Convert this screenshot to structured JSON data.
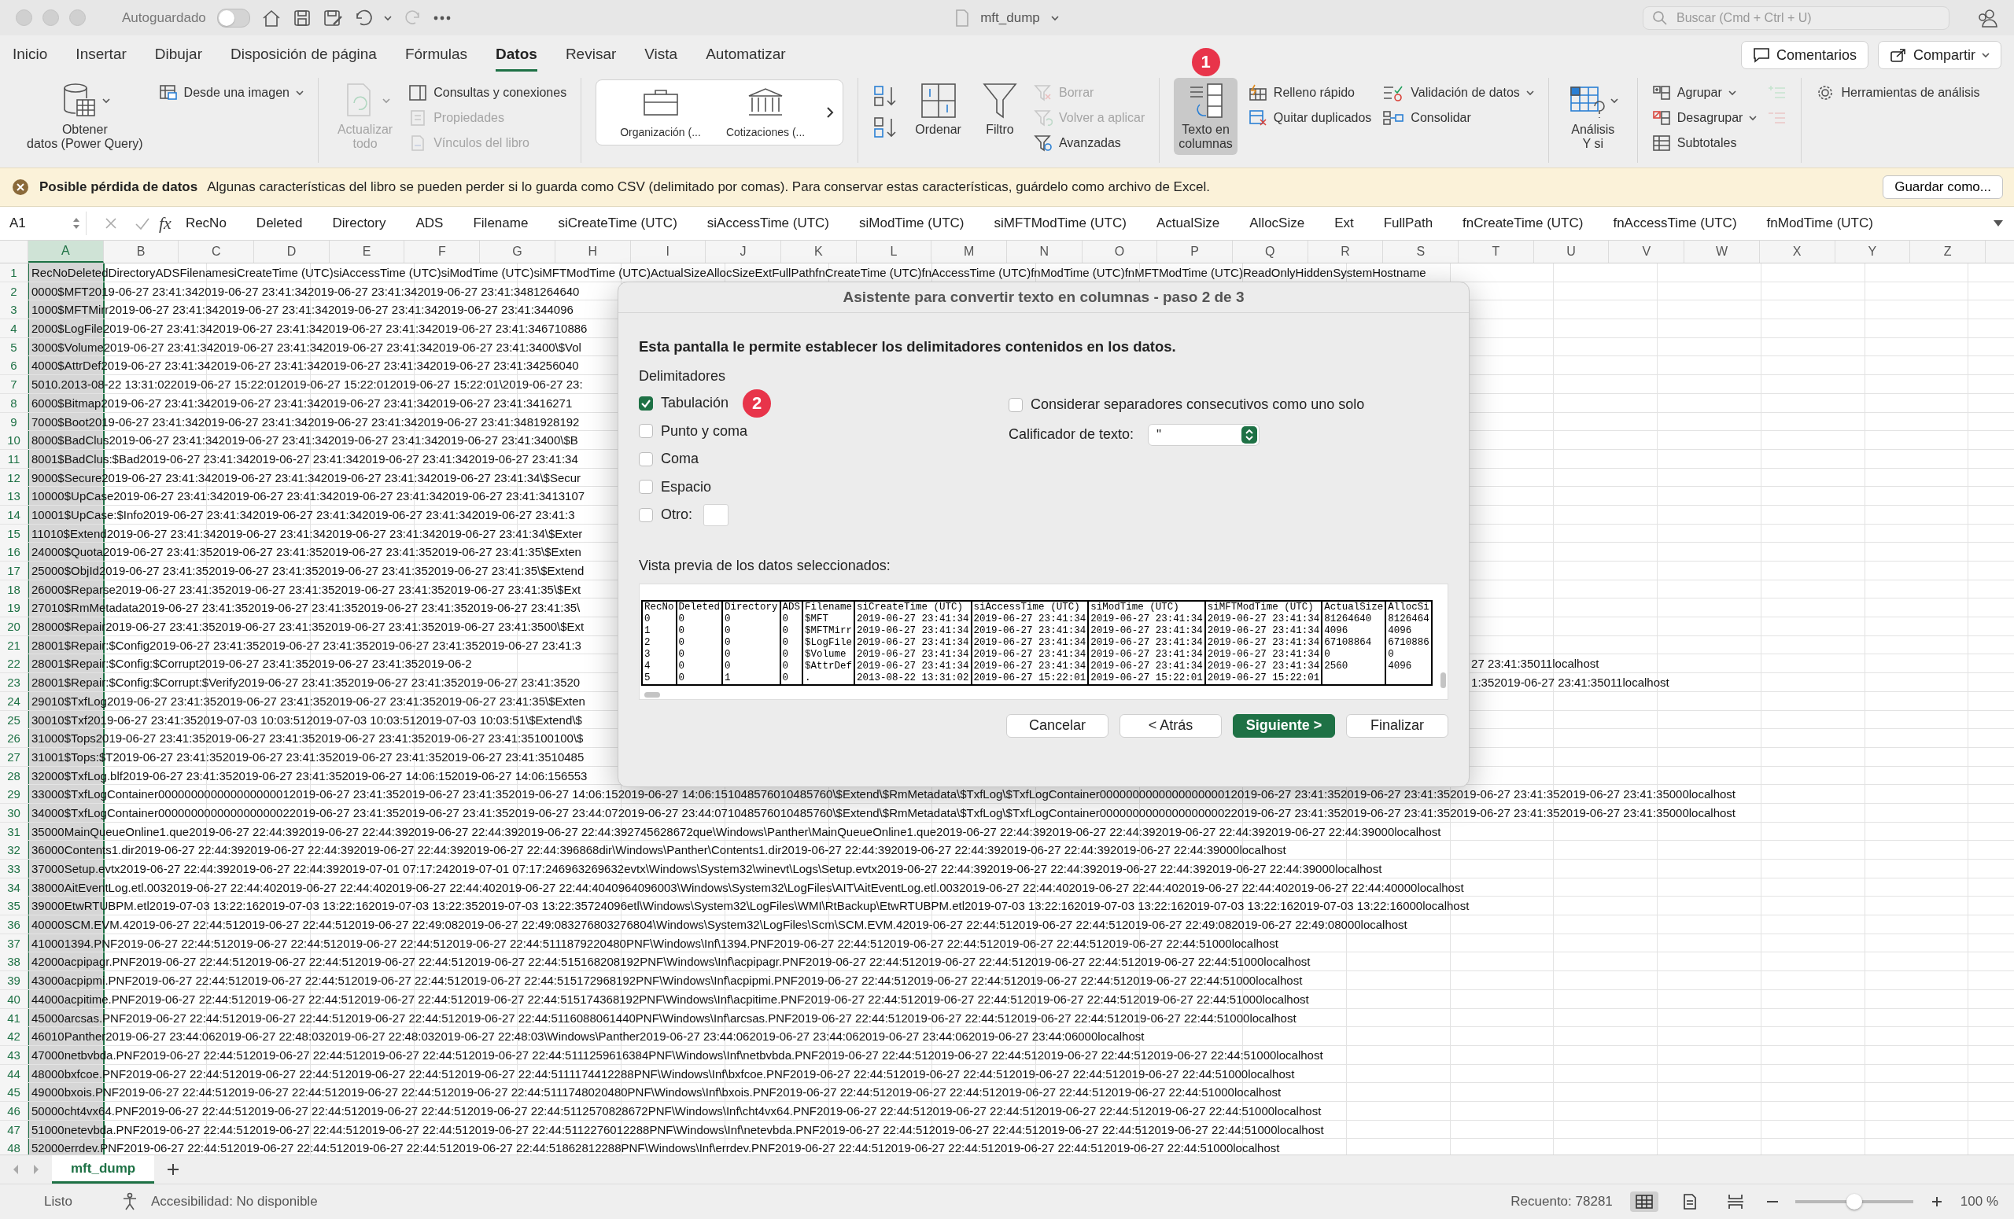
{
  "title_bar": {
    "autosave_label": "Autoguardado",
    "autosave_on": false,
    "file_name": "mft_dump",
    "search": {
      "placeholder": "Buscar (Cmd + Ctrl + U)"
    }
  },
  "ribbon_tabs": [
    {
      "label": "Inicio",
      "selected": false
    },
    {
      "label": "Insertar",
      "selected": false
    },
    {
      "label": "Dibujar",
      "selected": false
    },
    {
      "label": "Disposición de página",
      "selected": false
    },
    {
      "label": "Fórmulas",
      "selected": false
    },
    {
      "label": "Datos",
      "selected": true
    },
    {
      "label": "Revisar",
      "selected": false
    },
    {
      "label": "Vista",
      "selected": false
    },
    {
      "label": "Automatizar",
      "selected": false
    }
  ],
  "header_buttons": [
    {
      "label": "Comentarios",
      "dropdown": false
    },
    {
      "label": "Compartir",
      "dropdown": true
    }
  ],
  "ribbon": {
    "groups": [
      {
        "items": [
          {
            "kind": "large",
            "label": "Obtener\ndatos (Power Query)",
            "dropdown": true,
            "disabled": false
          },
          {
            "kind": "stack",
            "items": [
              {
                "label": "Desde una imagen",
                "dropdown": true,
                "disabled": false
              }
            ]
          }
        ]
      },
      {
        "items": [
          {
            "kind": "large",
            "label": "Actualizar\ntodo",
            "dropdown": true,
            "disabled": true
          },
          {
            "kind": "stack",
            "items": [
              {
                "label": "Consultas y conexiones",
                "dropdown": false,
                "disabled": false
              },
              {
                "label": "Propiedades",
                "dropdown": false,
                "disabled": true
              },
              {
                "label": "Vínculos del libro",
                "dropdown": false,
                "disabled": true
              }
            ]
          }
        ]
      },
      {
        "items": [
          {
            "kind": "gallery",
            "items": [
              {
                "label": "Organización (..."
              },
              {
                "label": "Cotizaciones (..."
              }
            ]
          }
        ]
      },
      {
        "items": [
          {
            "kind": "sort"
          },
          {
            "kind": "large",
            "label": "Ordenar",
            "dropdown": false,
            "disabled": false
          },
          {
            "kind": "large",
            "label": "Filtro",
            "dropdown": false,
            "disabled": false
          },
          {
            "kind": "stack",
            "items": [
              {
                "label": "Borrar",
                "dropdown": false,
                "disabled": true
              },
              {
                "label": "Volver a aplicar",
                "dropdown": false,
                "disabled": true
              },
              {
                "label": "Avanzadas",
                "dropdown": false,
                "disabled": false
              }
            ]
          }
        ]
      },
      {
        "items": [
          {
            "kind": "large",
            "label": "Texto en\ncolumnas",
            "dropdown": false,
            "disabled": false,
            "selected": true,
            "badge": "1"
          },
          {
            "kind": "stack",
            "items": [
              {
                "label": "Relleno rápido",
                "dropdown": false,
                "disabled": false
              },
              {
                "label": "Quitar duplicados",
                "dropdown": false,
                "disabled": false
              }
            ]
          },
          {
            "kind": "stack",
            "items": [
              {
                "label": "Validación de datos",
                "dropdown": true,
                "disabled": false
              },
              {
                "label": "Consolidar",
                "dropdown": false,
                "disabled": false
              }
            ]
          }
        ]
      },
      {
        "items": [
          {
            "kind": "large",
            "label": "Análisis\nY si",
            "dropdown": true,
            "disabled": false
          }
        ]
      },
      {
        "items": [
          {
            "kind": "stack",
            "items": [
              {
                "label": "Agrupar",
                "dropdown": true,
                "disabled": false
              },
              {
                "label": "Desagrupar",
                "dropdown": true,
                "disabled": false
              },
              {
                "label": "Subtotales",
                "dropdown": false,
                "disabled": false
              }
            ]
          },
          {
            "kind": "stack",
            "items": [
              {
                "dropdown": false,
                "disabled": true
              },
              {
                "dropdown": false,
                "disabled": true
              }
            ]
          }
        ]
      },
      {
        "items": [
          {
            "kind": "stack",
            "items": [
              {
                "label": "Herramientas de análisis",
                "dropdown": false,
                "disabled": false
              }
            ]
          }
        ]
      }
    ]
  },
  "banner": {
    "title": "Posible pérdida de datos",
    "message": "Algunas características del libro se pueden perder si lo guarda como CSV (delimitado por comas). Para conservar estas características, guárdelo como archivo de Excel.",
    "button": "Guardar como..."
  },
  "formula_bar": {
    "cell": "A1",
    "fx_label": "fx",
    "contents": [
      "RecNo",
      "Deleted",
      "Directory",
      "ADS",
      "Filename",
      "siCreateTime (UTC)",
      "siAccessTime (UTC)",
      "siModTime (UTC)",
      "siMFTModTime (UTC)",
      "ActualSize",
      "AllocSize",
      "Ext",
      "FullPath",
      "fnCreateTime (UTC)",
      "fnAccessTime (UTC)",
      "fnModTime (UTC)"
    ]
  },
  "sheet": {
    "columns": [
      {
        "label": "A",
        "selected": true
      },
      {
        "label": "B",
        "selected": false
      },
      {
        "label": "C",
        "selected": false
      },
      {
        "label": "D",
        "selected": false
      },
      {
        "label": "E",
        "selected": false
      },
      {
        "label": "F",
        "selected": false
      },
      {
        "label": "G",
        "selected": false
      },
      {
        "label": "H",
        "selected": false
      },
      {
        "label": "I",
        "selected": false
      },
      {
        "label": "J",
        "selected": false
      },
      {
        "label": "K",
        "selected": false
      },
      {
        "label": "L",
        "selected": false
      },
      {
        "label": "M",
        "selected": false
      },
      {
        "label": "N",
        "selected": false
      },
      {
        "label": "O",
        "selected": false
      },
      {
        "label": "P",
        "selected": false
      },
      {
        "label": "Q",
        "selected": false
      },
      {
        "label": "R",
        "selected": false
      },
      {
        "label": "S",
        "selected": false
      },
      {
        "label": "T",
        "selected": false
      },
      {
        "label": "U",
        "selected": false
      },
      {
        "label": "V",
        "selected": false
      },
      {
        "label": "W",
        "selected": false
      },
      {
        "label": "X",
        "selected": false
      },
      {
        "label": "Y",
        "selected": false
      },
      {
        "label": "Z",
        "selected": false
      }
    ],
    "rows": [
      {
        "number": "1",
        "text": "RecNoDeletedDirectoryADSFilenamesiCreateTime (UTC)siAccessTime (UTC)siModTime (UTC)siMFTModTime (UTC)ActualSizeAllocSizeExtFullPathfnCreateTime (UTC)fnAccessTime (UTC)fnModTime (UTC)fnMFTModTime (UTC)ReadOnlyHiddenSystemHostname"
      },
      {
        "number": "2",
        "text": "0000$MFT2019-06-27 23:41:342019-06-27 23:41:342019-06-27 23:41:342019-06-27 23:41:3481264640"
      },
      {
        "number": "3",
        "text": "1000$MFTMirr2019-06-27 23:41:342019-06-27 23:41:342019-06-27 23:41:342019-06-27 23:41:344096"
      },
      {
        "number": "4",
        "text": "2000$LogFile2019-06-27 23:41:342019-06-27 23:41:342019-06-27 23:41:342019-06-27 23:41:346710886"
      },
      {
        "number": "5",
        "text": "3000$Volume2019-06-27 23:41:342019-06-27 23:41:342019-06-27 23:41:342019-06-27 23:41:3400\\$Vol"
      },
      {
        "number": "6",
        "text": "4000$AttrDef2019-06-27 23:41:342019-06-27 23:41:342019-06-27 23:41:342019-06-27 23:41:34256040"
      },
      {
        "number": "7",
        "text": "5010.2013-08-22 13:31:022019-06-27 15:22:012019-06-27 15:22:012019-06-27 15:22:01\\2019-06-27 23:"
      },
      {
        "number": "8",
        "text": "6000$Bitmap2019-06-27 23:41:342019-06-27 23:41:342019-06-27 23:41:342019-06-27 23:41:3416271"
      },
      {
        "number": "9",
        "text": "7000$Boot2019-06-27 23:41:342019-06-27 23:41:342019-06-27 23:41:342019-06-27 23:41:3481928192"
      },
      {
        "number": "10",
        "text": "8000$BadClus2019-06-27 23:41:342019-06-27 23:41:342019-06-27 23:41:342019-06-27 23:41:3400\\$B"
      },
      {
        "number": "11",
        "text": "8001$BadClus:$Bad2019-06-27 23:41:342019-06-27 23:41:342019-06-27 23:41:342019-06-27 23:41:34"
      },
      {
        "number": "12",
        "text": "9000$Secure2019-06-27 23:41:342019-06-27 23:41:342019-06-27 23:41:342019-06-27 23:41:34\\$Secur"
      },
      {
        "number": "13",
        "text": "10000$UpCase2019-06-27 23:41:342019-06-27 23:41:342019-06-27 23:41:342019-06-27 23:41:3413107"
      },
      {
        "number": "14",
        "text": "10001$UpCase:$Info2019-06-27 23:41:342019-06-27 23:41:342019-06-27 23:41:342019-06-27 23:41:3"
      },
      {
        "number": "15",
        "text": "11010$Extend2019-06-27 23:41:342019-06-27 23:41:342019-06-27 23:41:342019-06-27 23:41:34\\$Exter"
      },
      {
        "number": "16",
        "text": "24000$Quota2019-06-27 23:41:352019-06-27 23:41:352019-06-27 23:41:352019-06-27 23:41:35\\$Exten"
      },
      {
        "number": "17",
        "text": "25000$ObjId2019-06-27 23:41:352019-06-27 23:41:352019-06-27 23:41:352019-06-27 23:41:35\\$Extend"
      },
      {
        "number": "18",
        "text": "26000$Reparse2019-06-27 23:41:352019-06-27 23:41:352019-06-27 23:41:352019-06-27 23:41:35\\$Ext"
      },
      {
        "number": "19",
        "text": "27010$RmMetadata2019-06-27 23:41:352019-06-27 23:41:352019-06-27 23:41:352019-06-27 23:41:35\\"
      },
      {
        "number": "20",
        "text": "28000$Repair2019-06-27 23:41:352019-06-27 23:41:352019-06-27 23:41:352019-06-27 23:41:3500\\$Ext"
      },
      {
        "number": "21",
        "text": "28001$Repair:$Config2019-06-27 23:41:352019-06-27 23:41:352019-06-27 23:41:352019-06-27 23:41:3"
      },
      {
        "number": "22",
        "text": "28001$Repair:$Config:$Corrupt2019-06-27 23:41:352019-06-27 23:41:352019-06-2",
        "text_right": "27 23:41:35011localhost"
      },
      {
        "number": "23",
        "text": "28001$Repair:$Config:$Corrupt:$Verify2019-06-27 23:41:352019-06-27 23:41:352019-06-27 23:41:3520",
        "text_right": "1:352019-06-27 23:41:35011localhost"
      },
      {
        "number": "24",
        "text": "29010$TxfLog2019-06-27 23:41:352019-06-27 23:41:352019-06-27 23:41:352019-06-27 23:41:35\\$Exten"
      },
      {
        "number": "25",
        "text": "30010$Txf2019-06-27 23:41:352019-07-03 10:03:512019-07-03 10:03:512019-07-03 10:03:51\\$Extend\\$"
      },
      {
        "number": "26",
        "text": "31000$Tops2019-06-27 23:41:352019-06-27 23:41:352019-06-27 23:41:352019-06-27 23:41:35100100\\$"
      },
      {
        "number": "27",
        "text": "31001$Tops:$T2019-06-27 23:41:352019-06-27 23:41:352019-06-27 23:41:352019-06-27 23:41:3510485"
      },
      {
        "number": "28",
        "text": "32000$TxfLog.blf2019-06-27 23:41:352019-06-27 23:41:352019-06-27 14:06:152019-06-27 14:06:156553"
      },
      {
        "number": "29",
        "text": "33000$TxfLogContainer000000000000000000012019-06-27 23:41:352019-06-27 23:41:352019-06-27 14:06:152019-06-27 14:06:151048576010485760\\$Extend\\$RmMetadata\\$TxfLog\\$TxfLogContainer000000000000000000012019-06-27 23:41:352019-06-27 23:41:352019-06-27 23:41:352019-06-27 23:41:35000localhost"
      },
      {
        "number": "30",
        "text": "34000$TxfLogContainer000000000000000000022019-06-27 23:41:352019-06-27 23:41:352019-06-27 23:44:072019-06-27 23:44:071048576010485760\\$Extend\\$RmMetadata\\$TxfLog\\$TxfLogContainer000000000000000000022019-06-27 23:41:352019-06-27 23:41:352019-06-27 23:41:352019-06-27 23:41:35000localhost"
      },
      {
        "number": "31",
        "text": "35000MainQueueOnline1.que2019-06-27 22:44:392019-06-27 22:44:392019-06-27 22:44:392019-06-27 22:44:392745628672que\\Windows\\Panther\\MainQueueOnline1.que2019-06-27 22:44:392019-06-27 22:44:392019-06-27 22:44:392019-06-27 22:44:39000localhost"
      },
      {
        "number": "32",
        "text": "36000Contents1.dir2019-06-27 22:44:392019-06-27 22:44:392019-06-27 22:44:392019-06-27 22:44:396868dir\\Windows\\Panther\\Contents1.dir2019-06-27 22:44:392019-06-27 22:44:392019-06-27 22:44:392019-06-27 22:44:39000localhost"
      },
      {
        "number": "33",
        "text": "37000Setup.evtx2019-06-27 22:44:392019-06-27 22:44:392019-07-01 07:17:242019-07-01 07:17:246963269632evtx\\Windows\\System32\\winevt\\Logs\\Setup.evtx2019-06-27 22:44:392019-06-27 22:44:392019-06-27 22:44:392019-06-27 22:44:39000localhost"
      },
      {
        "number": "34",
        "text": "38000AitEventLog.etl.0032019-06-27 22:44:402019-06-27 22:44:402019-06-27 22:44:402019-06-27 22:44:4040964096003\\Windows\\System32\\LogFiles\\AIT\\AitEventLog.etl.0032019-06-27 22:44:402019-06-27 22:44:402019-06-27 22:44:402019-06-27 22:44:40000localhost"
      },
      {
        "number": "35",
        "text": "39000EtwRTUBPM.etl2019-07-03 13:22:162019-07-03 13:22:162019-07-03 13:22:352019-07-03 13:22:35724096etl\\Windows\\System32\\LogFiles\\WMI\\RtBackup\\EtwRTUBPM.etl2019-07-03 13:22:162019-07-03 13:22:162019-07-03 13:22:162019-07-03 13:22:16000localhost"
      },
      {
        "number": "36",
        "text": "40000SCM.EVM.42019-06-27 22:44:512019-06-27 22:44:512019-06-27 22:49:082019-06-27 22:49:083276803276804\\Windows\\System32\\LogFiles\\Scm\\SCM.EVM.42019-06-27 22:44:512019-06-27 22:44:512019-06-27 22:49:082019-06-27 22:49:08000localhost"
      },
      {
        "number": "37",
        "text": "410001394.PNF2019-06-27 22:44:512019-06-27 22:44:512019-06-27 22:44:512019-06-27 22:44:5111879220480PNF\\Windows\\Inf\\1394.PNF2019-06-27 22:44:512019-06-27 22:44:512019-06-27 22:44:512019-06-27 22:44:51000localhost"
      },
      {
        "number": "38",
        "text": "42000acpipagr.PNF2019-06-27 22:44:512019-06-27 22:44:512019-06-27 22:44:512019-06-27 22:44:515168208192PNF\\Windows\\Inf\\acpipagr.PNF2019-06-27 22:44:512019-06-27 22:44:512019-06-27 22:44:512019-06-27 22:44:51000localhost"
      },
      {
        "number": "39",
        "text": "43000acpipmi.PNF2019-06-27 22:44:512019-06-27 22:44:512019-06-27 22:44:512019-06-27 22:44:515172968192PNF\\Windows\\Inf\\acpipmi.PNF2019-06-27 22:44:512019-06-27 22:44:512019-06-27 22:44:512019-06-27 22:44:51000localhost"
      },
      {
        "number": "40",
        "text": "44000acpitime.PNF2019-06-27 22:44:512019-06-27 22:44:512019-06-27 22:44:512019-06-27 22:44:515174368192PNF\\Windows\\Inf\\acpitime.PNF2019-06-27 22:44:512019-06-27 22:44:512019-06-27 22:44:512019-06-27 22:44:51000localhost"
      },
      {
        "number": "41",
        "text": "45000arcsas.PNF2019-06-27 22:44:512019-06-27 22:44:512019-06-27 22:44:512019-06-27 22:44:5116088061440PNF\\Windows\\Inf\\arcsas.PNF2019-06-27 22:44:512019-06-27 22:44:512019-06-27 22:44:512019-06-27 22:44:51000localhost"
      },
      {
        "number": "42",
        "text": "46010Panther2019-06-27 23:44:062019-06-27 22:48:032019-06-27 22:48:032019-06-27 22:48:03\\Windows\\Panther2019-06-27 23:44:062019-06-27 23:44:062019-06-27 23:44:062019-06-27 23:44:06000localhost"
      },
      {
        "number": "43",
        "text": "47000netbvbda.PNF2019-06-27 22:44:512019-06-27 22:44:512019-06-27 22:44:512019-06-27 22:44:5111259616384PNF\\Windows\\Inf\\netbvbda.PNF2019-06-27 22:44:512019-06-27 22:44:512019-06-27 22:44:512019-06-27 22:44:51000localhost"
      },
      {
        "number": "44",
        "text": "48000bxfcoe.PNF2019-06-27 22:44:512019-06-27 22:44:512019-06-27 22:44:512019-06-27 22:44:5111174412288PNF\\Windows\\Inf\\bxfcoe.PNF2019-06-27 22:44:512019-06-27 22:44:512019-06-27 22:44:512019-06-27 22:44:51000localhost"
      },
      {
        "number": "45",
        "text": "49000bxois.PNF2019-06-27 22:44:512019-06-27 22:44:512019-06-27 22:44:512019-06-27 22:44:5111748020480PNF\\Windows\\Inf\\bxois.PNF2019-06-27 22:44:512019-06-27 22:44:512019-06-27 22:44:512019-06-27 22:44:51000localhost"
      },
      {
        "number": "46",
        "text": "50000cht4vx64.PNF2019-06-27 22:44:512019-06-27 22:44:512019-06-27 22:44:512019-06-27 22:44:5112570828672PNF\\Windows\\Inf\\cht4vx64.PNF2019-06-27 22:44:512019-06-27 22:44:512019-06-27 22:44:512019-06-27 22:44:51000localhost"
      },
      {
        "number": "47",
        "text": "51000netevbda.PNF2019-06-27 22:44:512019-06-27 22:44:512019-06-27 22:44:512019-06-27 22:44:5112276012288PNF\\Windows\\Inf\\netevbda.PNF2019-06-27 22:44:512019-06-27 22:44:512019-06-27 22:44:512019-06-27 22:44:51000localhost"
      },
      {
        "number": "48",
        "text": "52000errdev.PNF2019-06-27 22:44:512019-06-27 22:44:512019-06-27 22:44:512019-06-27 22:44:51862812288PNF\\Windows\\Inf\\errdev.PNF2019-06-27 22:44:512019-06-27 22:44:512019-06-27 22:44:512019-06-27 22:44:51000localhost"
      }
    ]
  },
  "dialog": {
    "title": "Asistente para convertir texto en columnas - paso 2 de 3",
    "intro": "Esta pantalla le permite establecer los delimitadores contenidos en los datos.",
    "delimiters_label": "Delimitadores",
    "delimiters": [
      {
        "kind": "plain",
        "label": "Tabulación",
        "checked": true,
        "badge": "2"
      },
      {
        "kind": "plain",
        "label": "Punto y coma",
        "checked": false
      },
      {
        "kind": "plain",
        "label": "Coma",
        "checked": false
      },
      {
        "kind": "plain",
        "label": "Espacio",
        "checked": false
      },
      {
        "kind": "with_field",
        "label": "Otro:",
        "checked": false
      }
    ],
    "consecutive": {
      "label": "Considerar separadores consecutivos como uno solo",
      "checked": false
    },
    "qualifier": {
      "label": "Calificador de texto:",
      "value": "\""
    },
    "preview_label": "Vista previa de los datos seleccionados:",
    "preview": {
      "columns": [
        "RecNo",
        "Deleted",
        "Directory",
        "ADS",
        "Filename",
        "siCreateTime (UTC)",
        "siAccessTime (UTC)",
        "siModTime (UTC)",
        "siMFTModTime (UTC)",
        "ActualSize",
        "AllocSi"
      ],
      "rows": [
        [
          "0",
          "0",
          "0",
          "0",
          "$MFT",
          "2019-06-27 23:41:34",
          "2019-06-27 23:41:34",
          "2019-06-27 23:41:34",
          "2019-06-27 23:41:34",
          "81264640",
          "8126464"
        ],
        [
          "1",
          "0",
          "0",
          "0",
          "$MFTMirr",
          "2019-06-27 23:41:34",
          "2019-06-27 23:41:34",
          "2019-06-27 23:41:34",
          "2019-06-27 23:41:34",
          "4096",
          "4096"
        ],
        [
          "2",
          "0",
          "0",
          "0",
          "$LogFile",
          "2019-06-27 23:41:34",
          "2019-06-27 23:41:34",
          "2019-06-27 23:41:34",
          "2019-06-27 23:41:34",
          "67108864",
          "6710886"
        ],
        [
          "3",
          "0",
          "0",
          "0",
          "$Volume",
          "2019-06-27 23:41:34",
          "2019-06-27 23:41:34",
          "2019-06-27 23:41:34",
          "2019-06-27 23:41:34",
          "0",
          "0"
        ],
        [
          "4",
          "0",
          "0",
          "0",
          "$AttrDef",
          "2019-06-27 23:41:34",
          "2019-06-27 23:41:34",
          "2019-06-27 23:41:34",
          "2019-06-27 23:41:34",
          "2560",
          "4096"
        ],
        [
          "5",
          "0",
          "1",
          "0",
          ".",
          "2013-08-22 13:31:02",
          "2019-06-27 15:22:01",
          "2019-06-27 15:22:01",
          "2019-06-27 15:22:01",
          null,
          null
        ]
      ]
    },
    "buttons": [
      {
        "label": "Cancelar",
        "primary": false
      },
      {
        "label": "< Atrás",
        "primary": false
      },
      {
        "label": "Siguiente >",
        "primary": true
      },
      {
        "label": "Finalizar",
        "primary": false
      }
    ]
  },
  "sheet_tabs": [
    {
      "label": "mft_dump",
      "selected": true
    }
  ],
  "status_bar": {
    "status": "Listo",
    "accessibility": "Accesibilidad: No disponible",
    "count": "Recuento: 78281",
    "views": [
      {
        "selected": true
      },
      {
        "selected": false
      },
      {
        "selected": false
      }
    ],
    "zoom": {
      "level": 0.5,
      "reading": "100 %"
    }
  }
}
